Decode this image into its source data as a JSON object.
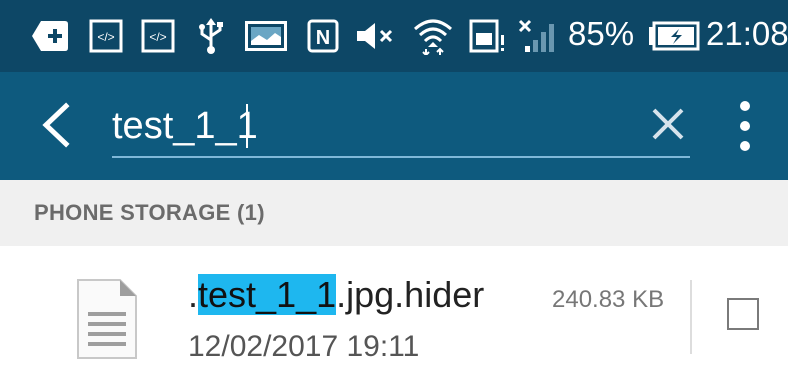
{
  "status_bar": {
    "battery_percent": "85%",
    "time": "21:08",
    "icons": [
      "plus-box-icon",
      "code-icon",
      "code-icon",
      "usb-icon",
      "image-icon",
      "nfc-icon",
      "mute-icon",
      "wifi-icon",
      "sim-alert-icon",
      "signal-icon",
      "battery-charging-icon"
    ]
  },
  "app_bar": {
    "search_value": "test_1_1",
    "back_icon": "back-arrow-icon",
    "clear_icon": "close-icon",
    "more_icon": "more-vert-icon"
  },
  "section": {
    "title": "PHONE STORAGE (1)"
  },
  "files": [
    {
      "name_prefix": ".",
      "name_match": "test_1_1",
      "name_suffix": ".jpg.hider",
      "date": "12/02/2017 19:11",
      "size": "240.83 KB",
      "checked": false
    }
  ],
  "colors": {
    "status_bar": "#0d4766",
    "app_bar": "#0e5a7e",
    "highlight": "#1eb7ef",
    "section_bg": "#f0f0f0"
  }
}
